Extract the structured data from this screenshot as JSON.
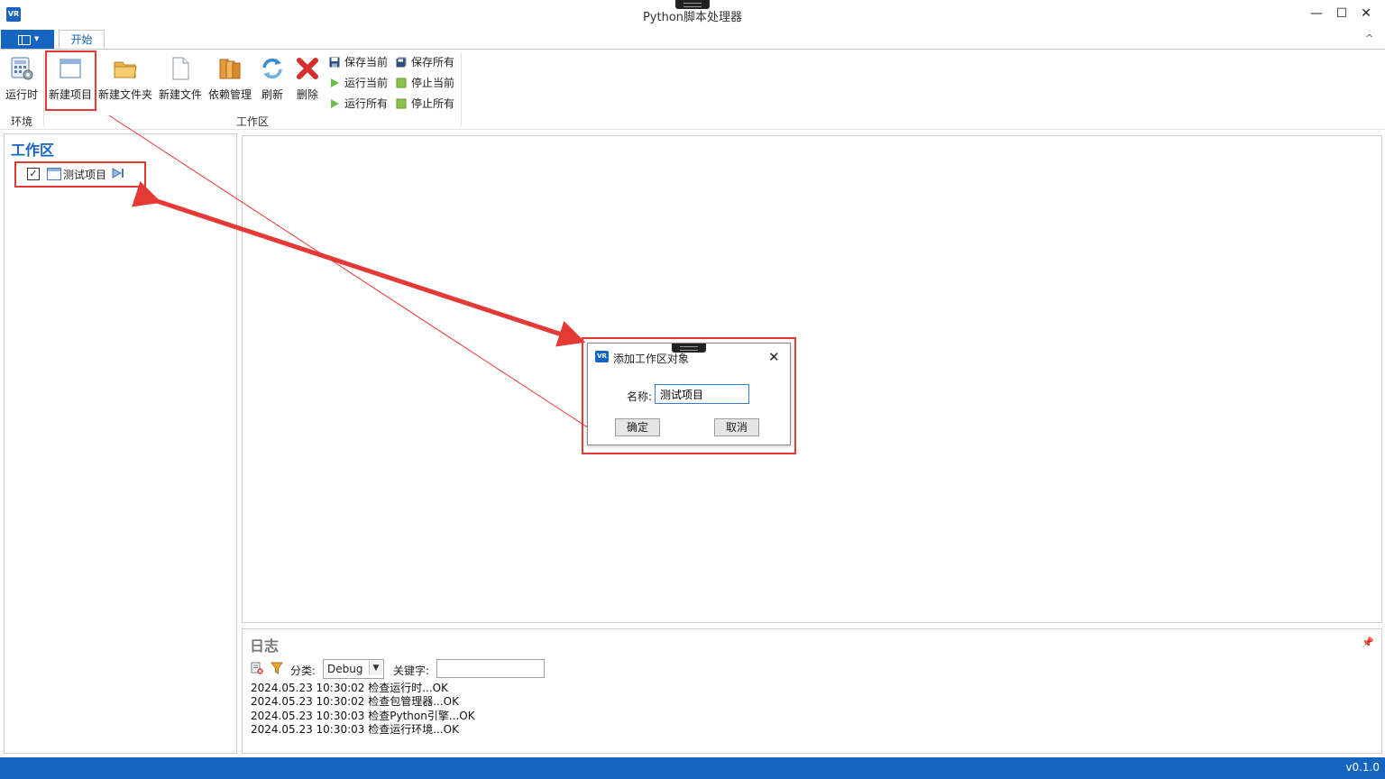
{
  "window": {
    "title": "Python脚本处理器",
    "app_icon_text": "VR",
    "minimize": "—",
    "maximize": "☐",
    "close": "✕",
    "collapse_ribbon": "^"
  },
  "ribbon": {
    "tab_start": "开始",
    "env_group_label": "环境",
    "workspace_group_label": "工作区",
    "runtime_label": "运行时",
    "new_project_label": "新建项目",
    "new_folder_label": "新建文件夹",
    "new_file_label": "新建文件",
    "dependency_label": "依赖管理",
    "refresh_label": "刷新",
    "delete_label": "删除",
    "save_current_label": "保存当前",
    "run_current_label": "运行当前",
    "run_all_label": "运行所有",
    "save_all_label": "保存所有",
    "stop_current_label": "停止当前",
    "stop_all_label": "停止所有"
  },
  "workspace": {
    "title": "工作区",
    "items": [
      {
        "label": "测试项目",
        "checked": true
      }
    ]
  },
  "log": {
    "title": "日志",
    "category_label": "分类:",
    "category_value": "Debug",
    "keyword_label": "关键字:",
    "keyword_value": "",
    "lines": [
      "2024.05.23 10:30:02 检查运行时...OK",
      "2024.05.23 10:30:02 检查包管理器...OK",
      "2024.05.23 10:30:03 检查Python引擎...OK",
      "2024.05.23 10:30:03 检查运行环境...OK"
    ]
  },
  "dialog": {
    "title": "添加工作区对象",
    "icon_text": "VR",
    "name_label": "名称:",
    "name_value": "测试项目",
    "ok_label": "确定",
    "cancel_label": "取消"
  },
  "status": {
    "version": "v0.1.0"
  },
  "colors": {
    "accent": "#1565c0",
    "highlight": "#e53935"
  }
}
